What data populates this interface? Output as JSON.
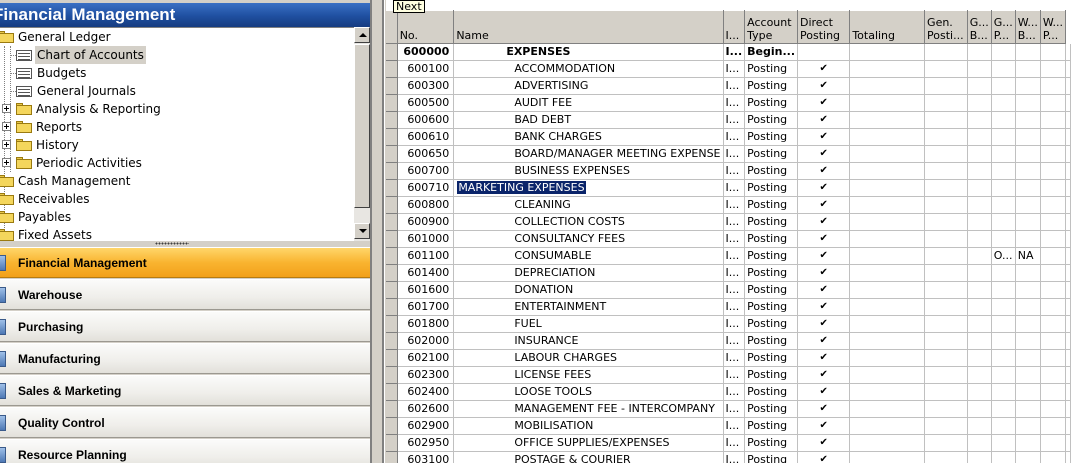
{
  "nav": {
    "title": "Financial Management",
    "tree": [
      {
        "label": "General Ledger",
        "icon": "folder-open-icon"
      },
      {
        "label": "Chart of Accounts",
        "icon": "form-icon",
        "selected": true
      },
      {
        "label": "Budgets",
        "icon": "form-icon"
      },
      {
        "label": "General Journals",
        "icon": "form-icon"
      },
      {
        "label": "Analysis & Reporting",
        "icon": "folder-icon"
      },
      {
        "label": "Reports",
        "icon": "folder-icon"
      },
      {
        "label": "History",
        "icon": "folder-icon"
      },
      {
        "label": "Periodic Activities",
        "icon": "folder-icon"
      },
      {
        "label": "Cash Management",
        "icon": "folder-icon"
      },
      {
        "label": "Receivables",
        "icon": "folder-icon"
      },
      {
        "label": "Payables",
        "icon": "folder-icon"
      },
      {
        "label": "Fixed Assets",
        "icon": "folder-icon"
      }
    ],
    "menu_buttons": [
      {
        "label": "Financial Management",
        "active": true
      },
      {
        "label": "Warehouse"
      },
      {
        "label": "Purchasing"
      },
      {
        "label": "Manufacturing"
      },
      {
        "label": "Sales & Marketing"
      },
      {
        "label": "Quality Control"
      },
      {
        "label": "Resource Planning"
      }
    ]
  },
  "tooltip": "Next",
  "grid": {
    "columns": [
      {
        "key": "no",
        "label": "No."
      },
      {
        "key": "name",
        "label": "Name"
      },
      {
        "key": "income_balance",
        "label": "I..."
      },
      {
        "key": "account_type",
        "label": "Account Type"
      },
      {
        "key": "direct_posting",
        "label": "Direct Posting"
      },
      {
        "key": "totaling",
        "label": "Totaling"
      },
      {
        "key": "gen_posting_type",
        "label": "Gen. Posti..."
      },
      {
        "key": "gen_bus",
        "label": "G... B..."
      },
      {
        "key": "gen_prod",
        "label": "G... P..."
      },
      {
        "key": "wht_bus",
        "label": "W... B..."
      },
      {
        "key": "wht_prod",
        "label": "W... P..."
      }
    ],
    "rows": [
      {
        "no": "600000",
        "name": "EXPENSES",
        "ib": "I...",
        "type": "Begin...",
        "direct": "",
        "heading": true
      },
      {
        "no": "600100",
        "name": "ACCOMMODATION",
        "ib": "I...",
        "type": "Posting",
        "direct": "✔"
      },
      {
        "no": "600300",
        "name": "ADVERTISING",
        "ib": "I...",
        "type": "Posting",
        "direct": "✔"
      },
      {
        "no": "600500",
        "name": "AUDIT FEE",
        "ib": "I...",
        "type": "Posting",
        "direct": "✔"
      },
      {
        "no": "600600",
        "name": "BAD DEBT",
        "ib": "I...",
        "type": "Posting",
        "direct": "✔"
      },
      {
        "no": "600610",
        "name": "BANK CHARGES",
        "ib": "I...",
        "type": "Posting",
        "direct": "✔"
      },
      {
        "no": "600650",
        "name": "BOARD/MANAGER MEETING EXPENSE",
        "ib": "I...",
        "type": "Posting",
        "direct": "✔"
      },
      {
        "no": "600700",
        "name": "BUSINESS EXPENSES",
        "ib": "I...",
        "type": "Posting",
        "direct": "✔"
      },
      {
        "no": "600710",
        "name": "MARKETING EXPENSES",
        "ib": "I...",
        "type": "Posting",
        "direct": "✔",
        "current": true
      },
      {
        "no": "600800",
        "name": "CLEANING",
        "ib": "I...",
        "type": "Posting",
        "direct": "✔"
      },
      {
        "no": "600900",
        "name": "COLLECTION COSTS",
        "ib": "I...",
        "type": "Posting",
        "direct": "✔"
      },
      {
        "no": "601000",
        "name": "CONSULTANCY FEES",
        "ib": "I...",
        "type": "Posting",
        "direct": "✔"
      },
      {
        "no": "601100",
        "name": "CONSUMABLE",
        "ib": "I...",
        "type": "Posting",
        "direct": "✔",
        "gen_prod": "O...",
        "wht_bus": "NA"
      },
      {
        "no": "601400",
        "name": "DEPRECIATION",
        "ib": "I...",
        "type": "Posting",
        "direct": "✔"
      },
      {
        "no": "601600",
        "name": "DONATION",
        "ib": "I...",
        "type": "Posting",
        "direct": "✔"
      },
      {
        "no": "601700",
        "name": "ENTERTAINMENT",
        "ib": "I...",
        "type": "Posting",
        "direct": "✔"
      },
      {
        "no": "601800",
        "name": "FUEL",
        "ib": "I...",
        "type": "Posting",
        "direct": "✔"
      },
      {
        "no": "602000",
        "name": "INSURANCE",
        "ib": "I...",
        "type": "Posting",
        "direct": "✔"
      },
      {
        "no": "602100",
        "name": "LABOUR CHARGES",
        "ib": "I...",
        "type": "Posting",
        "direct": "✔"
      },
      {
        "no": "602300",
        "name": "LICENSE FEES",
        "ib": "I...",
        "type": "Posting",
        "direct": "✔"
      },
      {
        "no": "602400",
        "name": "LOOSE TOOLS",
        "ib": "I...",
        "type": "Posting",
        "direct": "✔"
      },
      {
        "no": "602600",
        "name": "MANAGEMENT FEE - INTERCOMPANY",
        "ib": "I...",
        "type": "Posting",
        "direct": "✔"
      },
      {
        "no": "602900",
        "name": "MOBILISATION",
        "ib": "I...",
        "type": "Posting",
        "direct": "✔"
      },
      {
        "no": "602950",
        "name": "OFFICE SUPPLIES/EXPENSES",
        "ib": "I...",
        "type": "Posting",
        "direct": "✔"
      },
      {
        "no": "603100",
        "name": "POSTAGE & COURIER",
        "ib": "I...",
        "type": "Posting",
        "direct": "✔"
      }
    ]
  }
}
